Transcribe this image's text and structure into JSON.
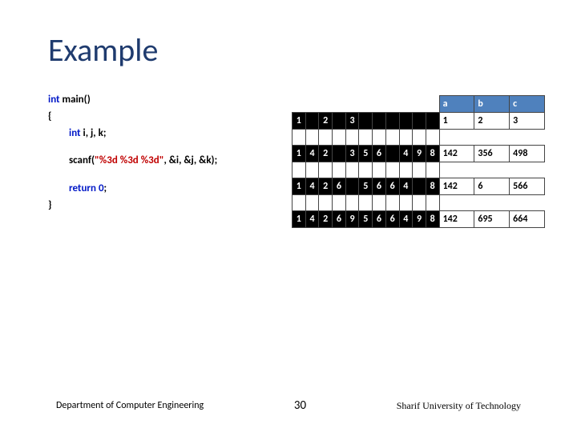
{
  "title": "Example",
  "code": {
    "l1a": "int ",
    "l1b": "main()",
    "l2": "{",
    "l3a": "int ",
    "l3b": "i, j, k;",
    "l4a": "scanf(",
    "l4b": "\"%3d %3d %3d\"",
    "l4c": ", &i, &j, &k);",
    "l5a": "return ",
    "l5b": "0",
    "l5c": ";",
    "l6": "}"
  },
  "hdr": {
    "a": "a",
    "b": "b",
    "c": "c"
  },
  "rows": [
    {
      "cells": [
        "1",
        "",
        "2",
        "",
        "3",
        "",
        "",
        "",
        "",
        ""
      ],
      "a": "1",
      "b": "2",
      "c": "3"
    },
    {
      "cells": [
        "1",
        "4",
        "2",
        "",
        "3",
        "5",
        "6",
        "",
        "4",
        "9",
        "8"
      ],
      "a": "142",
      "b": "356",
      "c": "498"
    },
    {
      "cells": [
        "1",
        "4",
        "2",
        "6",
        "",
        "5",
        "6",
        "6",
        "4",
        "",
        "8"
      ],
      "a": "142",
      "b": "6",
      "c": "566"
    },
    {
      "cells": [
        "1",
        "4",
        "2",
        "6",
        "9",
        "5",
        "6",
        "6",
        "4",
        "9",
        "8"
      ],
      "a": "142",
      "b": "695",
      "c": "664"
    }
  ],
  "footer": {
    "dept": "Department of Computer Engineering",
    "page": "30",
    "uni": "Sharif University of Technology"
  }
}
